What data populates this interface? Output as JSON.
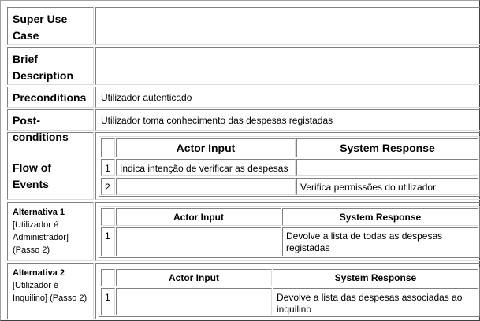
{
  "labels": {
    "super_use_case": "Super Use Case",
    "brief_description": "Brief Description",
    "preconditions": "Preconditions",
    "postconditions": "Post-conditions",
    "flow_of_events": "Flow of Events",
    "alt1_title": "Alternativa 1",
    "alt1_sub": "[Utilizador é Administrador] (Passo 2)",
    "alt2_title": "Alternativa 2",
    "alt2_sub": "[Utilizador é Inquilino] (Passo 2)"
  },
  "values": {
    "super_use_case": "",
    "brief_description": "",
    "preconditions": "Utilizador autenticado",
    "postconditions": "Utilizador toma conhecimento das despesas registadas"
  },
  "table_headers": {
    "actor_input": "Actor Input",
    "system_response": "System Response"
  },
  "flow_rows": [
    {
      "n": "1",
      "actor": "Indica intenção de verificar as despesas",
      "system": ""
    },
    {
      "n": "2",
      "actor": "",
      "system": "Verifica permissões do utilizador"
    }
  ],
  "alt1_rows": [
    {
      "n": "1",
      "actor": "",
      "system": "Devolve a lista de todas as despesas registadas"
    }
  ],
  "alt2_rows": [
    {
      "n": "1",
      "actor": "",
      "system": "Devolve a lista das despesas associadas ao inquilino"
    }
  ]
}
